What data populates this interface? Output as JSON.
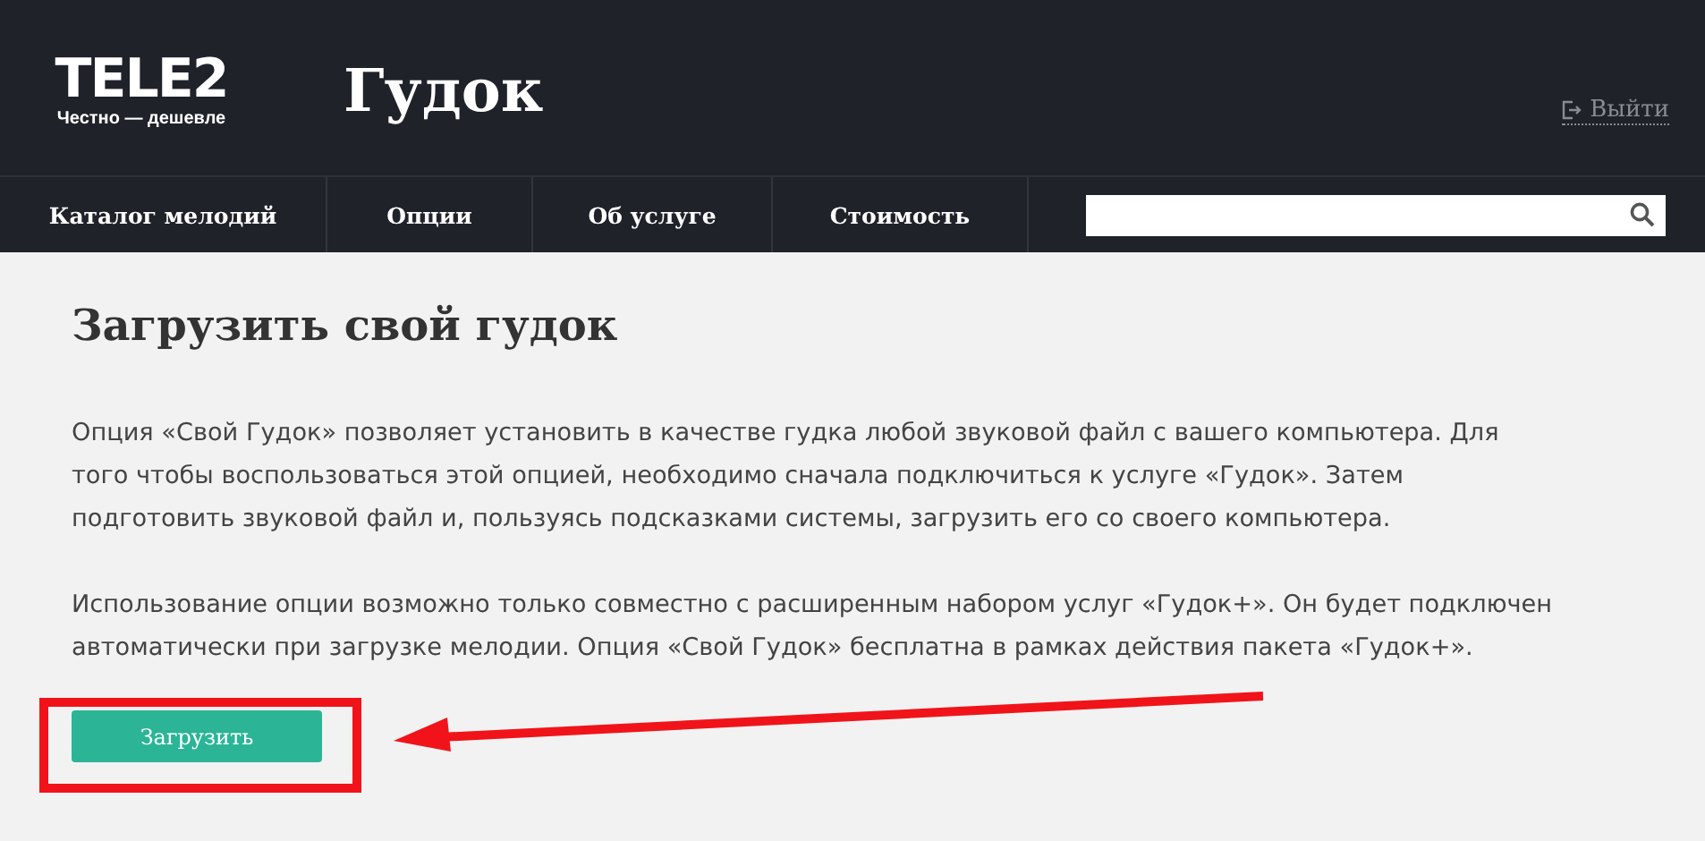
{
  "header": {
    "logo": "TELE2",
    "slogan": "Честно — дешевле",
    "title": "Гудок",
    "logout": "Выйти"
  },
  "nav": {
    "items": [
      "Каталог мелодий",
      "Опции",
      "Об услуге",
      "Стоимость"
    ]
  },
  "content": {
    "heading": "Загрузить свой гудок",
    "paragraphs": [
      "Опция «Свой Гудок» позволяет установить в качестве гудка любой звуковой файл с вашего компьютера. Для того чтобы воспользоваться этой опцией, необходимо сначала подключиться к услуге «Гудок». Затем подготовить звуковой файл и, пользуясь подсказками системы, загрузить его со своего компьютера.",
      "Использование опции возможно только совместно с расширенным набором услуг «Гудок+». Он будет подключен автоматически при загрузке мелодии. Опция «Свой Гудок» бесплатна в рамках действия пакета «Гудок+»."
    ],
    "button": "Загрузить"
  }
}
